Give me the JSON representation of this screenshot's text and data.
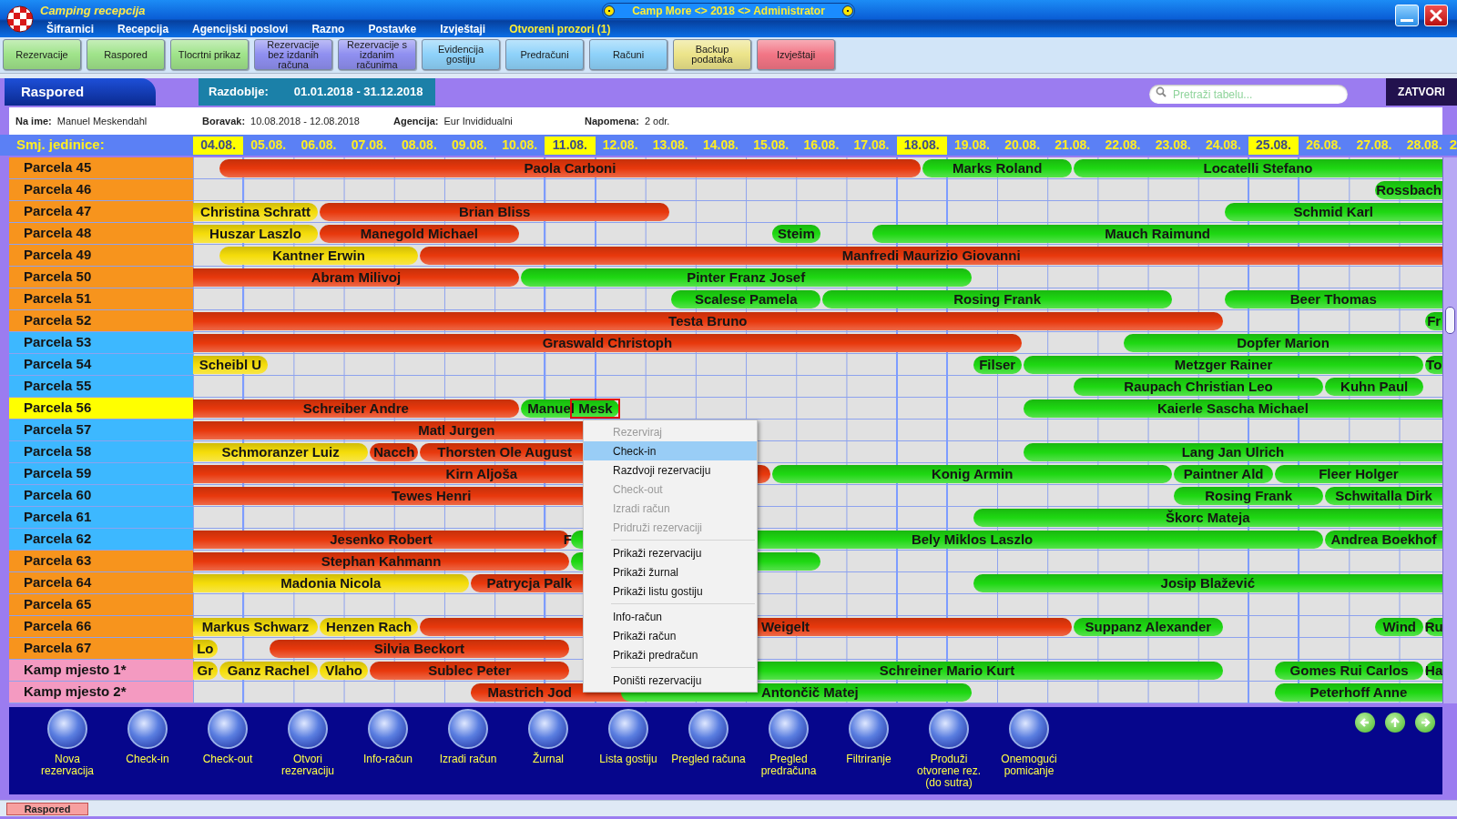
{
  "window": {
    "title": "Camping recepcija",
    "session": "Camp More <> 2018 <> Administrator"
  },
  "menu": [
    {
      "label": "Šifrarnici",
      "kind": "menu"
    },
    {
      "label": "Recepcija",
      "kind": "menu"
    },
    {
      "label": "Agencijski poslovi",
      "kind": "menu"
    },
    {
      "label": "Razno",
      "kind": "menu"
    },
    {
      "label": "Postavke",
      "kind": "menu"
    },
    {
      "label": "Izvještaji",
      "kind": "menu"
    },
    {
      "label": "Otvoreni prozori (1)",
      "kind": "windows"
    }
  ],
  "toolbar": [
    {
      "label": "Rezervacije",
      "color": "#9fe38a"
    },
    {
      "label": "Raspored",
      "color": "#9fe38a"
    },
    {
      "label": "Tlocrtni prikaz",
      "color": "#9fe38a"
    },
    {
      "label": "Rezervacije bez izdanih računa",
      "color": "#8f8ff0"
    },
    {
      "label": "Rezervacije s izdanim računima",
      "color": "#8f8ff0"
    },
    {
      "label": "Evidencija gostiju",
      "color": "#8ed2fa"
    },
    {
      "label": "Predračuni",
      "color": "#8ed2fa"
    },
    {
      "label": "Računi",
      "color": "#8ed2fa"
    },
    {
      "label": "Backup podataka",
      "color": "#ece48a"
    },
    {
      "label": "Izvještaji",
      "color": "#f27585"
    }
  ],
  "panel": {
    "title": "Raspored",
    "period_label": "Razdoblje:",
    "period": "01.01.2018 - 31.12.2018",
    "search": {
      "placeholder": "Pretraži tabelu..."
    },
    "close": "ZATVORI"
  },
  "details": [
    {
      "label": "Na ime:",
      "value": "Manuel Meskendahl"
    },
    {
      "label": "Boravak:",
      "value": "10.08.2018 - 12.08.2018"
    },
    {
      "label": "Agencija:",
      "value": "Eur Invididualni"
    },
    {
      "label": "Napomena:",
      "value": "2 odr."
    }
  ],
  "schedule": {
    "units_label": "Smj. jedinice:",
    "days": [
      {
        "label": "04.08.",
        "highlighted": true
      },
      {
        "label": "05.08.",
        "highlighted": false
      },
      {
        "label": "06.08.",
        "highlighted": false
      },
      {
        "label": "07.08.",
        "highlighted": false
      },
      {
        "label": "08.08.",
        "highlighted": false
      },
      {
        "label": "09.08.",
        "highlighted": false
      },
      {
        "label": "10.08.",
        "highlighted": false
      },
      {
        "label": "11.08.",
        "highlighted": true
      },
      {
        "label": "12.08.",
        "highlighted": false
      },
      {
        "label": "13.08.",
        "highlighted": false
      },
      {
        "label": "14.08.",
        "highlighted": false
      },
      {
        "label": "15.08.",
        "highlighted": false
      },
      {
        "label": "16.08.",
        "highlighted": false
      },
      {
        "label": "17.08.",
        "highlighted": false
      },
      {
        "label": "18.08.",
        "highlighted": true
      },
      {
        "label": "19.08.",
        "highlighted": false
      },
      {
        "label": "20.08.",
        "highlighted": false
      },
      {
        "label": "21.08.",
        "highlighted": false
      },
      {
        "label": "22.08.",
        "highlighted": false
      },
      {
        "label": "23.08.",
        "highlighted": false
      },
      {
        "label": "24.08.",
        "highlighted": false
      },
      {
        "label": "25.08.",
        "highlighted": true
      },
      {
        "label": "26.08.",
        "highlighted": false
      },
      {
        "label": "27.08.",
        "highlighted": false
      },
      {
        "label": "28.08.",
        "highlighted": false
      },
      {
        "label": "2",
        "highlighted": false
      }
    ],
    "rows": [
      {
        "unit": "Parcela 45",
        "color": "#f7941d",
        "selected": false,
        "bookings": [
          {
            "name": "Paola Carboni",
            "color": "#e8380c",
            "selected": false
          },
          {
            "name": "Marks Roland",
            "color": "#1ed812",
            "selected": false
          },
          {
            "name": "Locatelli Stefano",
            "color": "#1ed812",
            "selected": false
          }
        ]
      },
      {
        "unit": "Parcela 46",
        "color": "#f7941d",
        "selected": false,
        "bookings": [
          {
            "name": "Rossbach",
            "color": "#1ed812",
            "selected": false
          }
        ]
      },
      {
        "unit": "Parcela 47",
        "color": "#f7941d",
        "selected": false,
        "bookings": [
          {
            "name": "Christina Schratt",
            "color": "#f5dd0a",
            "selected": false
          },
          {
            "name": "Brian Bliss",
            "color": "#e8380c",
            "selected": false
          },
          {
            "name": "Schmid Karl",
            "color": "#1ed812",
            "selected": false
          }
        ]
      },
      {
        "unit": "Parcela 48",
        "color": "#f7941d",
        "selected": false,
        "bookings": [
          {
            "name": "Huszar Laszlo",
            "color": "#f5dd0a",
            "selected": false
          },
          {
            "name": "Manegold Michael",
            "color": "#e8380c",
            "selected": false
          },
          {
            "name": "Steim",
            "color": "#1ed812",
            "selected": false
          },
          {
            "name": "Mauch Raimund",
            "color": "#1ed812",
            "selected": false
          }
        ]
      },
      {
        "unit": "Parcela 49",
        "color": "#f7941d",
        "selected": false,
        "bookings": [
          {
            "name": "Kantner Erwin",
            "color": "#f5dd0a",
            "selected": false
          },
          {
            "name": "Manfredi Maurizio Giovanni",
            "color": "#e8380c",
            "selected": false
          }
        ]
      },
      {
        "unit": "Parcela 50",
        "color": "#f7941d",
        "selected": false,
        "bookings": [
          {
            "name": "Abram Milivoj",
            "color": "#e8380c",
            "selected": false
          },
          {
            "name": "Pinter Franz Josef",
            "color": "#1ed812",
            "selected": false
          }
        ]
      },
      {
        "unit": "Parcela 51",
        "color": "#f7941d",
        "selected": false,
        "bookings": [
          {
            "name": "Scalese Pamela",
            "color": "#1ed812",
            "selected": false
          },
          {
            "name": "Rosing Frank",
            "color": "#1ed812",
            "selected": false
          },
          {
            "name": "Beer Thomas",
            "color": "#1ed812",
            "selected": false
          }
        ]
      },
      {
        "unit": "Parcela 52",
        "color": "#f7941d",
        "selected": false,
        "bookings": [
          {
            "name": "Testa Bruno",
            "color": "#e8380c",
            "selected": false
          },
          {
            "name": "Fr",
            "color": "#1ed812",
            "selected": false
          }
        ]
      },
      {
        "unit": "Parcela 53",
        "color": "#3db8ff",
        "selected": false,
        "bookings": [
          {
            "name": "Graswald Christoph",
            "color": "#e8380c",
            "selected": false
          },
          {
            "name": "Dopfer Marion",
            "color": "#1ed812",
            "selected": false
          }
        ]
      },
      {
        "unit": "Parcela 54",
        "color": "#3db8ff",
        "selected": false,
        "bookings": [
          {
            "name": "Scheibl U",
            "color": "#f5dd0a",
            "selected": false
          },
          {
            "name": "Filser",
            "color": "#1ed812",
            "selected": false
          },
          {
            "name": "Metzger Rainer",
            "color": "#1ed812",
            "selected": false
          },
          {
            "name": "To",
            "color": "#1ed812",
            "selected": false
          }
        ]
      },
      {
        "unit": "Parcela 55",
        "color": "#3db8ff",
        "selected": false,
        "bookings": [
          {
            "name": "Raupach Christian Leo",
            "color": "#1ed812",
            "selected": false
          },
          {
            "name": "Kuhn Paul",
            "color": "#1ed812",
            "selected": false
          }
        ]
      },
      {
        "unit": "Parcela 56",
        "selected": true,
        "bookings": [
          {
            "name": "Schreiber Andre",
            "color": "#e8380c",
            "selected": false
          },
          {
            "name": "Manuel Mesk",
            "color": "#1ed812",
            "selected": true
          },
          {
            "name": "Kaierle Sascha Michael",
            "color": "#1ed812",
            "selected": false
          }
        ]
      },
      {
        "unit": "Parcela 57",
        "color": "#3db8ff",
        "selected": false,
        "bookings": [
          {
            "name": "Matl Jurgen",
            "color": "#e8380c",
            "selected": false
          }
        ]
      },
      {
        "unit": "Parcela 58",
        "color": "#3db8ff",
        "selected": false,
        "bookings": [
          {
            "name": "Schmoranzer Luiz",
            "color": "#f5dd0a",
            "selected": false
          },
          {
            "name": "Nacch",
            "color": "#e8380c",
            "selected": false
          },
          {
            "name": "Thorsten Ole August",
            "color": "#e8380c",
            "selected": false
          },
          {
            "name": "Lang Jan Ulrich",
            "color": "#1ed812",
            "selected": false
          }
        ]
      },
      {
        "unit": "Parcela 59",
        "color": "#3db8ff",
        "selected": false,
        "bookings": [
          {
            "name": "Kirn Aljoša",
            "color": "#e8380c",
            "selected": false
          },
          {
            "name": "Konig Armin",
            "color": "#1ed812",
            "selected": false
          },
          {
            "name": "Paintner Ald",
            "color": "#1ed812",
            "selected": false
          },
          {
            "name": "Fleer Holger",
            "color": "#1ed812",
            "selected": false
          }
        ]
      },
      {
        "unit": "Parcela 60",
        "color": "#3db8ff",
        "selected": false,
        "bookings": [
          {
            "name": "Tewes Henri",
            "color": "#e8380c",
            "selected": false
          },
          {
            "name": "Rosing Frank",
            "color": "#1ed812",
            "selected": false
          },
          {
            "name": "Schwitalla Dirk",
            "color": "#1ed812",
            "selected": false
          }
        ]
      },
      {
        "unit": "Parcela 61",
        "color": "#3db8ff",
        "selected": false,
        "bookings": [
          {
            "name": "Škorc Mateja",
            "color": "#1ed812",
            "selected": false
          }
        ]
      },
      {
        "unit": "Parcela 62",
        "color": "#3db8ff",
        "selected": false,
        "bookings": [
          {
            "name": "Jesenko Robert",
            "color": "#e8380c",
            "selected": false
          },
          {
            "name": "F",
            "color": "#1ed812",
            "selected": false
          },
          {
            "name": "Bely Miklos Laszlo",
            "color": "#1ed812",
            "selected": false
          },
          {
            "name": "Andrea Boekhof",
            "color": "#1ed812",
            "selected": false
          }
        ]
      },
      {
        "unit": "Parcela 63",
        "color": "#f7941d",
        "selected": false,
        "bookings": [
          {
            "name": "Stephan Kahmann",
            "color": "#e8380c",
            "selected": false
          },
          {
            "color": "#1ed812",
            "selected": false
          }
        ]
      },
      {
        "unit": "Parcela 64",
        "color": "#f7941d",
        "selected": false,
        "bookings": [
          {
            "name": "Madonia Nicola",
            "color": "#f5dd0a",
            "selected": false
          },
          {
            "name": "Patrycja Palk",
            "color": "#e8380c",
            "selected": false
          },
          {
            "name": "Josip Blažević",
            "color": "#1ed812",
            "selected": false
          }
        ]
      },
      {
        "unit": "Parcela 65",
        "color": "#f7941d",
        "selected": false
      },
      {
        "unit": "Parcela 66",
        "color": "#f7941d",
        "selected": false,
        "bookings": [
          {
            "name": "Markus Schwarz",
            "color": "#f5dd0a",
            "selected": false
          },
          {
            "name": "Henzen Rach",
            "color": "#f5dd0a",
            "selected": false
          },
          {
            "name": "Weigelt",
            "color": "#e8380c",
            "selected": false
          },
          {
            "name": "Suppanz Alexander",
            "color": "#1ed812",
            "selected": false
          },
          {
            "name": "Wind",
            "color": "#1ed812",
            "selected": false
          },
          {
            "name": "Ru",
            "color": "#1ed812",
            "selected": false
          }
        ]
      },
      {
        "unit": "Parcela 67",
        "color": "#f7941d",
        "selected": false,
        "bookings": [
          {
            "name": "Lo",
            "color": "#f5dd0a",
            "selected": false
          },
          {
            "name": "Silvia Beckort",
            "color": "#e8380c",
            "selected": false
          }
        ]
      },
      {
        "unit": "Kamp mjesto 1*",
        "color": "#f49ac1",
        "selected": false,
        "bookings": [
          {
            "name": "Gr",
            "color": "#f5dd0a",
            "selected": false
          },
          {
            "name": "Ganz Rachel",
            "color": "#f5dd0a",
            "selected": false
          },
          {
            "name": "Vlaho",
            "color": "#f5dd0a",
            "selected": false
          },
          {
            "name": "Sublec Peter",
            "color": "#e8380c",
            "selected": false
          },
          {
            "name": "Schreiner Mario Kurt",
            "color": "#1ed812",
            "selected": false
          },
          {
            "name": "Gomes Rui Carlos",
            "color": "#1ed812",
            "selected": false
          },
          {
            "name": "Ha",
            "color": "#1ed812",
            "selected": false
          }
        ]
      },
      {
        "unit": "Kamp mjesto 2*",
        "color": "#f49ac1",
        "selected": false,
        "bookings": [
          {
            "name": "Mastrich Jod",
            "color": "#e8380c",
            "selected": false
          },
          {
            "name": "Antončič Matej",
            "color": "#1ed812",
            "selected": false
          },
          {
            "name": "Peterhoff Anne",
            "color": "#1ed812",
            "selected": false
          }
        ]
      }
    ]
  },
  "context_menu": [
    {
      "kind": "item",
      "label": "Rezerviraj",
      "disabled": true,
      "selected": false
    },
    {
      "kind": "item",
      "label": "Check-in",
      "disabled": false,
      "selected": true
    },
    {
      "kind": "item",
      "label": "Razdvoji rezervaciju",
      "disabled": false,
      "selected": false
    },
    {
      "kind": "item",
      "label": "Check-out",
      "disabled": true,
      "selected": false
    },
    {
      "kind": "item",
      "label": "Izradi račun",
      "disabled": true,
      "selected": false
    },
    {
      "kind": "item",
      "label": "Pridruži rezervaciji",
      "disabled": true,
      "selected": false
    },
    {
      "kind": "separator"
    },
    {
      "kind": "item",
      "label": "Prikaži rezervaciju",
      "disabled": false,
      "selected": false
    },
    {
      "kind": "item",
      "label": "Prikaži žurnal",
      "disabled": false,
      "selected": false
    },
    {
      "kind": "item",
      "label": "Prikaži listu gostiju",
      "disabled": false,
      "selected": false
    },
    {
      "kind": "separator"
    },
    {
      "kind": "item",
      "label": "Info-račun",
      "disabled": false,
      "selected": false
    },
    {
      "kind": "item",
      "label": "Prikaži račun",
      "disabled": false,
      "selected": false
    },
    {
      "kind": "item",
      "label": "Prikaži predračun",
      "disabled": false,
      "selected": false
    },
    {
      "kind": "separator"
    },
    {
      "kind": "item",
      "label": "Poništi rezervaciju",
      "disabled": false,
      "selected": false
    }
  ],
  "actions": [
    {
      "label": "Nova rezervacija"
    },
    {
      "label": "Check-in"
    },
    {
      "label": "Check-out"
    },
    {
      "label": "Otvori rezervaciju"
    },
    {
      "label": "Info-račun"
    },
    {
      "label": "Izradi račun"
    },
    {
      "label": "Žurnal"
    },
    {
      "label": "Lista gostiju"
    },
    {
      "label": "Pregled računa"
    },
    {
      "label": "Pregled predračuna"
    },
    {
      "label": "Filtriranje"
    },
    {
      "label": "Produži otvorene rez. (do sutra)"
    },
    {
      "label": "Onemogući pomicanje"
    }
  ],
  "status_tabs": [
    {
      "label": "Raspored"
    }
  ]
}
